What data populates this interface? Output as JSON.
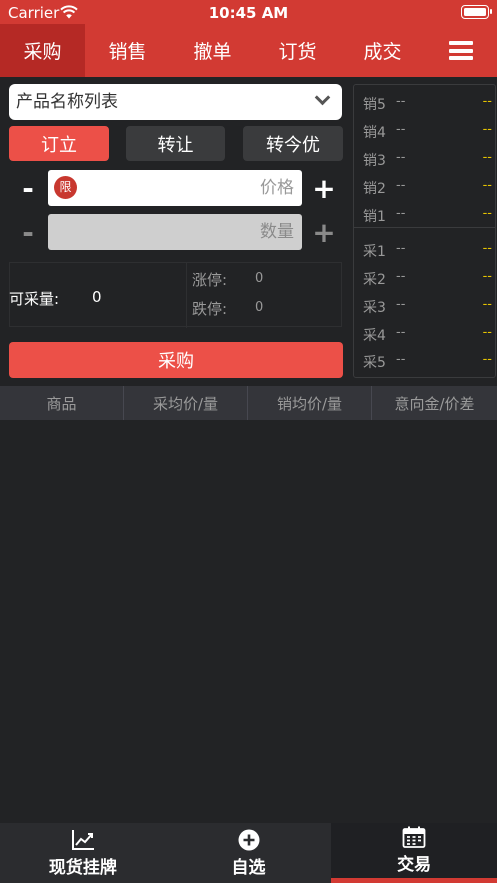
{
  "status_bar": {
    "carrier": "Carrier",
    "time": "10:45 AM"
  },
  "top_tabs": [
    {
      "label": "采购",
      "active": true
    },
    {
      "label": "销售",
      "active": false
    },
    {
      "label": "撤单",
      "active": false
    },
    {
      "label": "订货",
      "active": false
    },
    {
      "label": "成交",
      "active": false
    }
  ],
  "form": {
    "product_select": "产品名称列表",
    "modes": [
      "订立",
      "转让",
      "转今优"
    ],
    "limit_badge": "限",
    "price_placeholder": "价格",
    "quantity_placeholder": "数量",
    "minus": "-",
    "plus": "+",
    "available_label": "可采量:",
    "available_value": "0",
    "limit_up_label": "涨停:",
    "limit_up_value": "0",
    "limit_down_label": "跌停:",
    "limit_down_value": "0",
    "submit_label": "采购"
  },
  "order_book": {
    "sell": [
      {
        "label": "销5",
        "price": "--",
        "volume": "--"
      },
      {
        "label": "销4",
        "price": "--",
        "volume": "--"
      },
      {
        "label": "销3",
        "price": "--",
        "volume": "--"
      },
      {
        "label": "销2",
        "price": "--",
        "volume": "--"
      },
      {
        "label": "销1",
        "price": "--",
        "volume": "--"
      }
    ],
    "buy": [
      {
        "label": "采1",
        "price": "--",
        "volume": "--"
      },
      {
        "label": "采2",
        "price": "--",
        "volume": "--"
      },
      {
        "label": "采3",
        "price": "--",
        "volume": "--"
      },
      {
        "label": "采4",
        "price": "--",
        "volume": "--"
      },
      {
        "label": "采5",
        "price": "--",
        "volume": "--"
      }
    ]
  },
  "table": {
    "headers": [
      "商品",
      "采均价/量",
      "销均价/量",
      "意向金/价差"
    ]
  },
  "bottom_tabs": [
    {
      "label": "现货挂牌",
      "icon": "chart-line-icon",
      "active": false
    },
    {
      "label": "自选",
      "icon": "add-circle-icon",
      "active": false
    },
    {
      "label": "交易",
      "icon": "calendar-icon",
      "active": true
    }
  ],
  "colors": {
    "header_red": "#d23a33",
    "active_tab": "#b52925",
    "accent": "#ec5048",
    "book_volume": "#e6c400"
  }
}
